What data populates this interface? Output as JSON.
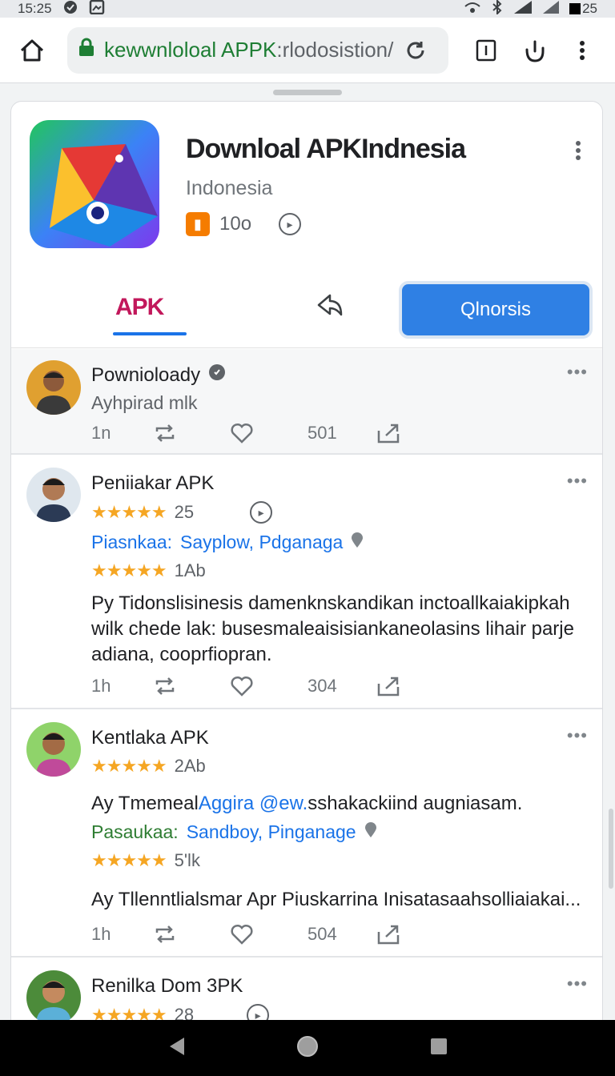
{
  "status_bar": {
    "time": "15:25",
    "battery": "25"
  },
  "browser": {
    "url_host": "kewwnloloal APPK",
    "url_path": ":rlodosistion/"
  },
  "app": {
    "title": "Downloal APKIndnesia",
    "subtitle": "Indonesia",
    "badge_count": "10o",
    "tab_apk": "APK",
    "primary_button": "Qlnorsis"
  },
  "posts": [
    {
      "name": "Pownioloady",
      "subtitle": "Ayhpirad mlk",
      "time": "1n",
      "count": "501"
    },
    {
      "name": "Peniiakar APK",
      "rating_count": "25",
      "link_label": "Piasnkaa:",
      "link_text": "Sayplow, Pdganaga",
      "rating2_count": "1Ab",
      "body": "Py Tidonslisinesis damenknskandikan inctoallkaiakipkah wilk chede lak: busesmaleaisisiankaneolasins lihair parje adiana, cooprfiopran.",
      "time": "1h",
      "count": "304"
    },
    {
      "name": "Kentlaka APK",
      "rating_count": "2Ab",
      "line_prefix": "Ay Tmemeal",
      "line_link": "Aggira @ew.",
      "line_rest": "sshakackiind augniasam.",
      "link_label": "Pasaukaa:",
      "link_text": "Sandboy, Pinganage",
      "rating2_count": "5'lk",
      "body": "Ay Tllenntlialsmar Apr Piuskarrina Inisatasaahsolliaiakai...",
      "time": "1h",
      "count": "504"
    },
    {
      "name": "Renilka Dom 3PK",
      "rating_count": "28"
    }
  ],
  "colors": {
    "accent": "#2f80e4",
    "brand_tab": "#c2185b",
    "star": "#f5a623"
  }
}
